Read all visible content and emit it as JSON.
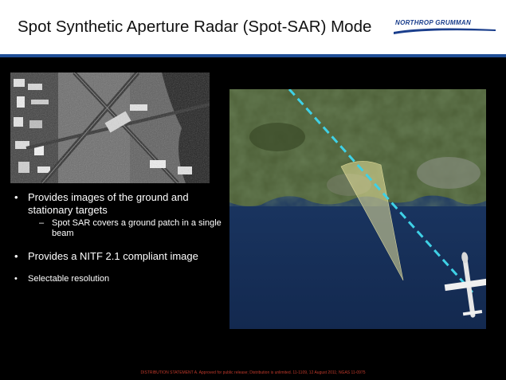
{
  "slide": {
    "title": "Spot Synthetic Aperture Radar (Spot-SAR) Mode",
    "logo": {
      "text": "NORTHROP GRUMMAN",
      "color": "#1a3e8c"
    },
    "rule_color": "#1f4e96",
    "bullets": [
      {
        "text": "Provides images of the ground and stationary targets",
        "sub": [
          "Spot SAR covers a ground patch in a single beam"
        ]
      },
      {
        "text": "Provides a NITF 2.1 compliant image",
        "sub": []
      },
      {
        "text": "Selectable resolution",
        "sub": []
      }
    ],
    "footer": "DISTRIBUTION STATEMENT A. Approved for public release; Distribution is unlimited. 11-1109, 12 August 2011; NGAS 11-0975"
  }
}
